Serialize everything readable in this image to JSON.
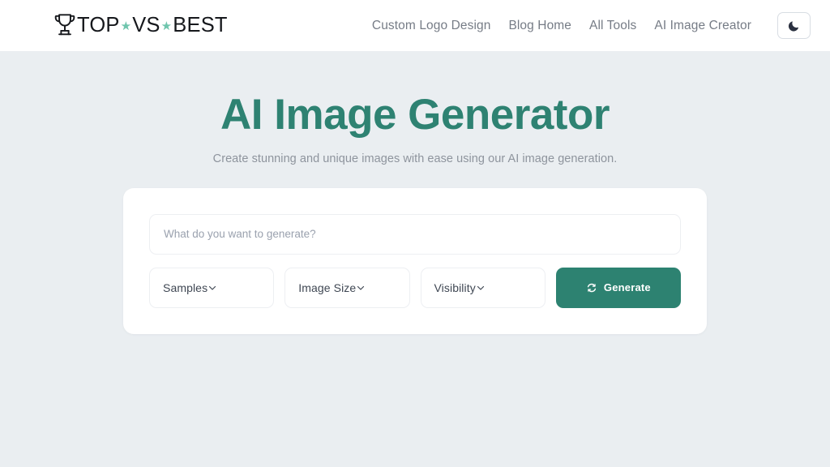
{
  "header": {
    "logo": {
      "icon": "trophy-icon",
      "part1": "TOP",
      "star1": "★",
      "part2": "VS",
      "star2": "★",
      "part3": "BEST",
      "star_color": "#6fc5ad",
      "text_color": "#16181c"
    },
    "nav": [
      {
        "label": "Custom Logo Design"
      },
      {
        "label": "Blog Home"
      },
      {
        "label": "All Tools"
      },
      {
        "label": "AI Image Creator"
      }
    ],
    "theme_toggle": {
      "icon": "moon-icon",
      "aria_label": "Toggle dark mode"
    }
  },
  "main": {
    "title": "AI Image Generator",
    "subtitle": "Create stunning and unique images with ease using our AI image generation.",
    "title_color": "#2e8272"
  },
  "generator": {
    "prompt": {
      "value": "",
      "placeholder": "What do you want to generate?"
    },
    "selects": [
      {
        "label": "Samples",
        "icon": "chevron-down-icon"
      },
      {
        "label": "Image Size",
        "icon": "chevron-down-icon"
      },
      {
        "label": "Visibility",
        "icon": "chevron-down-icon"
      }
    ],
    "generate_button": {
      "label": "Generate",
      "icon": "sync-icon",
      "color": "#2d8271"
    }
  },
  "page": {
    "background": "#eaeef1",
    "card_background": "#ffffff"
  }
}
